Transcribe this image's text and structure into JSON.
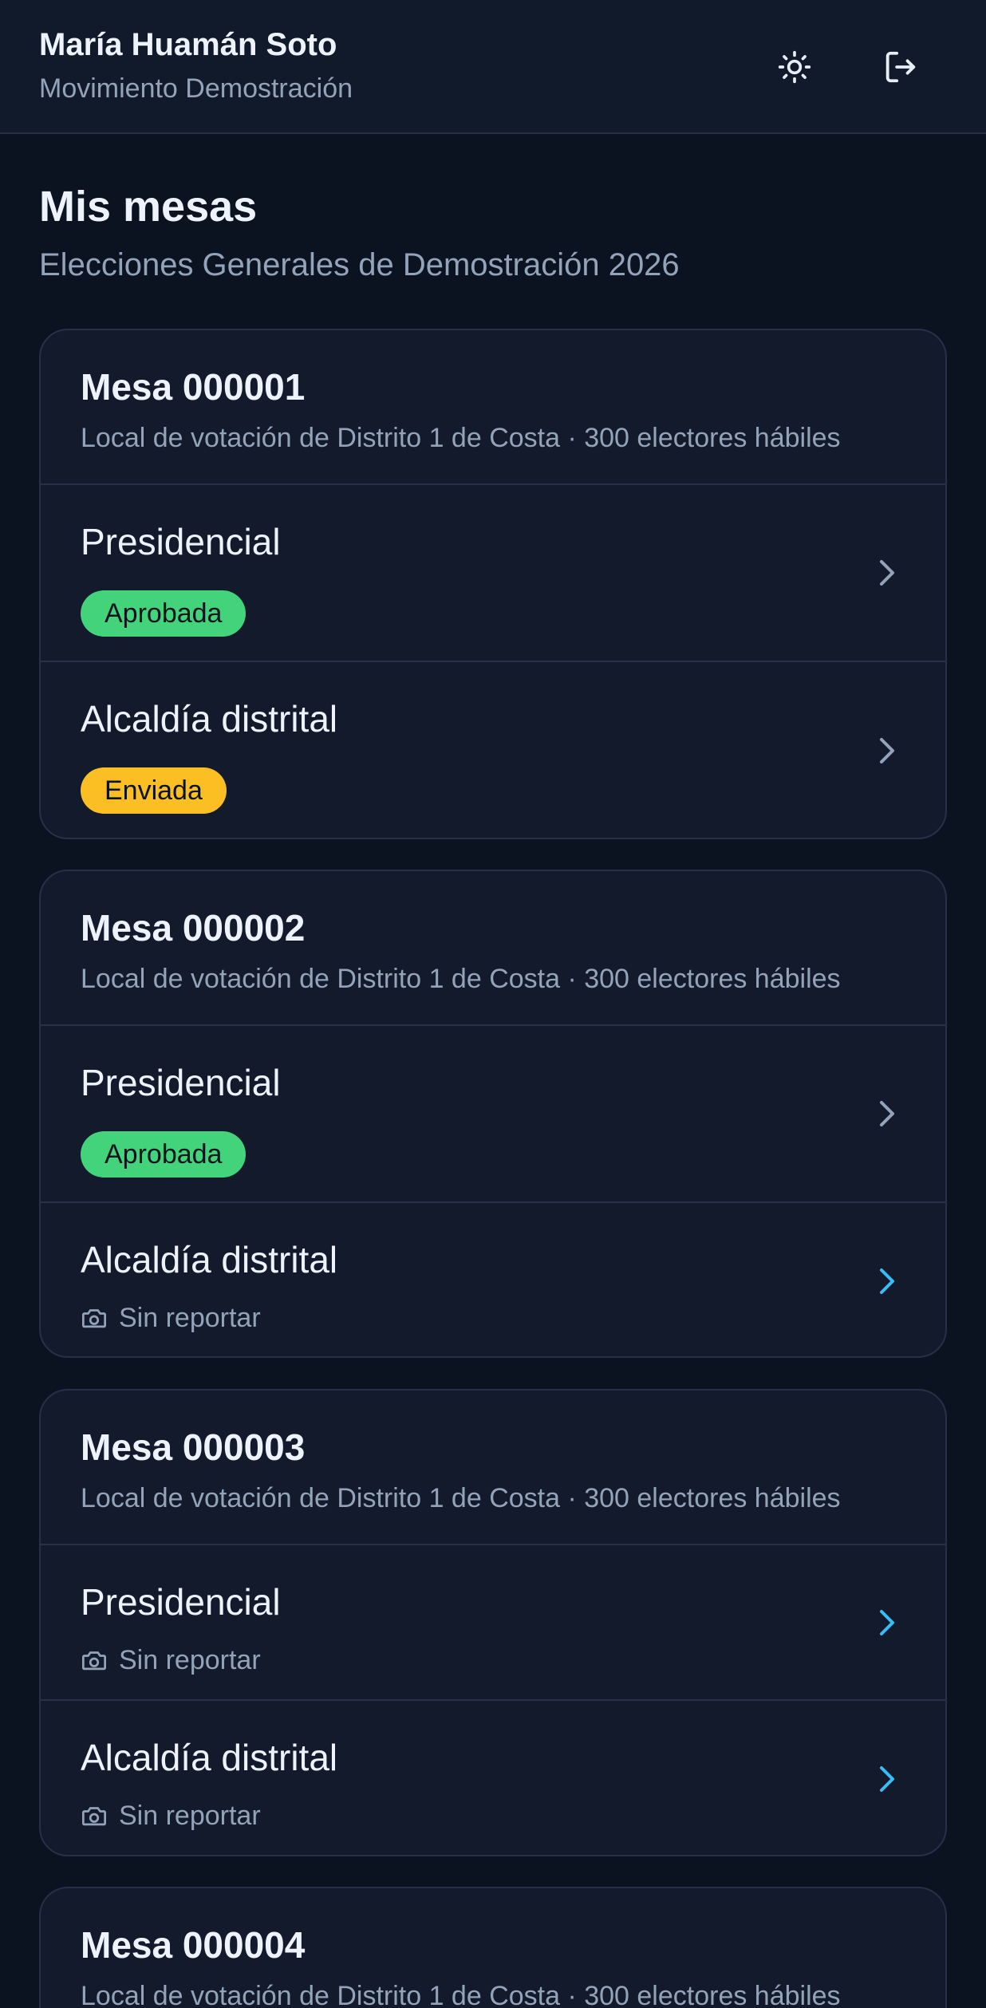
{
  "header": {
    "user_name": "María Huamán Soto",
    "organization": "Movimiento Demostración",
    "theme_icon": "sun-icon",
    "logout_icon": "logout-icon"
  },
  "page": {
    "title": "Mis mesas",
    "subtitle": "Elecciones Generales de Demostración 2026"
  },
  "colors": {
    "approved": "#43d37a",
    "sent": "#fbbf24",
    "chevron_pending": "#38bdf8",
    "chevron_done": "#94a3b8"
  },
  "mesas": [
    {
      "title": "Mesa 000001",
      "subtitle": "Local de votación de Distrito 1 de Costa · 300 electores hábiles",
      "rows": [
        {
          "label": "Presidencial",
          "status": "Aprobada"
        },
        {
          "label": "Alcaldía distrital",
          "status": "Enviada"
        }
      ]
    },
    {
      "title": "Mesa 000002",
      "subtitle": "Local de votación de Distrito 1 de Costa · 300 electores hábiles",
      "rows": [
        {
          "label": "Presidencial",
          "status": "Aprobada"
        },
        {
          "label": "Alcaldía distrital",
          "status": "Sin reportar"
        }
      ]
    },
    {
      "title": "Mesa 000003",
      "subtitle": "Local de votación de Distrito 1 de Costa · 300 electores hábiles",
      "rows": [
        {
          "label": "Presidencial",
          "status": "Sin reportar"
        },
        {
          "label": "Alcaldía distrital",
          "status": "Sin reportar"
        }
      ]
    },
    {
      "title": "Mesa 000004",
      "subtitle": "Local de votación de Distrito 1 de Costa · 300 electores hábiles",
      "rows": []
    }
  ]
}
